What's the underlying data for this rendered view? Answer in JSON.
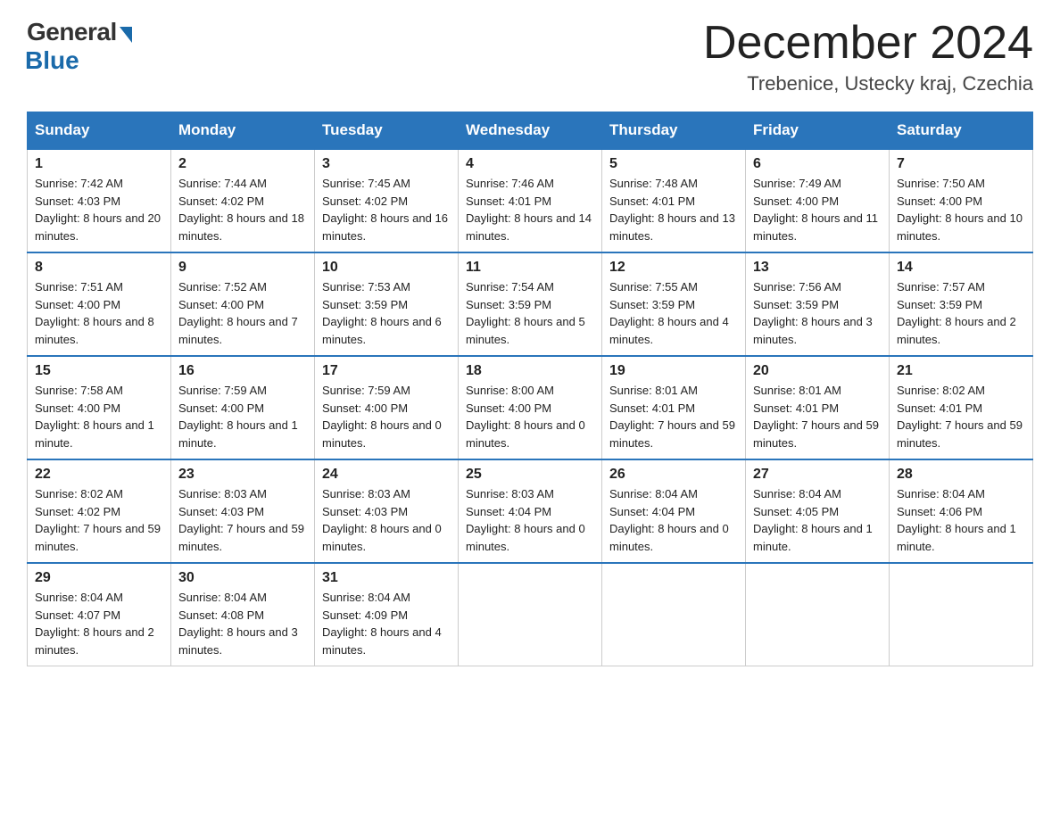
{
  "logo": {
    "general_text": "General",
    "blue_text": "Blue"
  },
  "title": {
    "month_year": "December 2024",
    "location": "Trebenice, Ustecky kraj, Czechia"
  },
  "headers": [
    "Sunday",
    "Monday",
    "Tuesday",
    "Wednesday",
    "Thursday",
    "Friday",
    "Saturday"
  ],
  "weeks": [
    [
      {
        "day": "1",
        "sunrise": "Sunrise: 7:42 AM",
        "sunset": "Sunset: 4:03 PM",
        "daylight": "Daylight: 8 hours and 20 minutes."
      },
      {
        "day": "2",
        "sunrise": "Sunrise: 7:44 AM",
        "sunset": "Sunset: 4:02 PM",
        "daylight": "Daylight: 8 hours and 18 minutes."
      },
      {
        "day": "3",
        "sunrise": "Sunrise: 7:45 AM",
        "sunset": "Sunset: 4:02 PM",
        "daylight": "Daylight: 8 hours and 16 minutes."
      },
      {
        "day": "4",
        "sunrise": "Sunrise: 7:46 AM",
        "sunset": "Sunset: 4:01 PM",
        "daylight": "Daylight: 8 hours and 14 minutes."
      },
      {
        "day": "5",
        "sunrise": "Sunrise: 7:48 AM",
        "sunset": "Sunset: 4:01 PM",
        "daylight": "Daylight: 8 hours and 13 minutes."
      },
      {
        "day": "6",
        "sunrise": "Sunrise: 7:49 AM",
        "sunset": "Sunset: 4:00 PM",
        "daylight": "Daylight: 8 hours and 11 minutes."
      },
      {
        "day": "7",
        "sunrise": "Sunrise: 7:50 AM",
        "sunset": "Sunset: 4:00 PM",
        "daylight": "Daylight: 8 hours and 10 minutes."
      }
    ],
    [
      {
        "day": "8",
        "sunrise": "Sunrise: 7:51 AM",
        "sunset": "Sunset: 4:00 PM",
        "daylight": "Daylight: 8 hours and 8 minutes."
      },
      {
        "day": "9",
        "sunrise": "Sunrise: 7:52 AM",
        "sunset": "Sunset: 4:00 PM",
        "daylight": "Daylight: 8 hours and 7 minutes."
      },
      {
        "day": "10",
        "sunrise": "Sunrise: 7:53 AM",
        "sunset": "Sunset: 3:59 PM",
        "daylight": "Daylight: 8 hours and 6 minutes."
      },
      {
        "day": "11",
        "sunrise": "Sunrise: 7:54 AM",
        "sunset": "Sunset: 3:59 PM",
        "daylight": "Daylight: 8 hours and 5 minutes."
      },
      {
        "day": "12",
        "sunrise": "Sunrise: 7:55 AM",
        "sunset": "Sunset: 3:59 PM",
        "daylight": "Daylight: 8 hours and 4 minutes."
      },
      {
        "day": "13",
        "sunrise": "Sunrise: 7:56 AM",
        "sunset": "Sunset: 3:59 PM",
        "daylight": "Daylight: 8 hours and 3 minutes."
      },
      {
        "day": "14",
        "sunrise": "Sunrise: 7:57 AM",
        "sunset": "Sunset: 3:59 PM",
        "daylight": "Daylight: 8 hours and 2 minutes."
      }
    ],
    [
      {
        "day": "15",
        "sunrise": "Sunrise: 7:58 AM",
        "sunset": "Sunset: 4:00 PM",
        "daylight": "Daylight: 8 hours and 1 minute."
      },
      {
        "day": "16",
        "sunrise": "Sunrise: 7:59 AM",
        "sunset": "Sunset: 4:00 PM",
        "daylight": "Daylight: 8 hours and 1 minute."
      },
      {
        "day": "17",
        "sunrise": "Sunrise: 7:59 AM",
        "sunset": "Sunset: 4:00 PM",
        "daylight": "Daylight: 8 hours and 0 minutes."
      },
      {
        "day": "18",
        "sunrise": "Sunrise: 8:00 AM",
        "sunset": "Sunset: 4:00 PM",
        "daylight": "Daylight: 8 hours and 0 minutes."
      },
      {
        "day": "19",
        "sunrise": "Sunrise: 8:01 AM",
        "sunset": "Sunset: 4:01 PM",
        "daylight": "Daylight: 7 hours and 59 minutes."
      },
      {
        "day": "20",
        "sunrise": "Sunrise: 8:01 AM",
        "sunset": "Sunset: 4:01 PM",
        "daylight": "Daylight: 7 hours and 59 minutes."
      },
      {
        "day": "21",
        "sunrise": "Sunrise: 8:02 AM",
        "sunset": "Sunset: 4:01 PM",
        "daylight": "Daylight: 7 hours and 59 minutes."
      }
    ],
    [
      {
        "day": "22",
        "sunrise": "Sunrise: 8:02 AM",
        "sunset": "Sunset: 4:02 PM",
        "daylight": "Daylight: 7 hours and 59 minutes."
      },
      {
        "day": "23",
        "sunrise": "Sunrise: 8:03 AM",
        "sunset": "Sunset: 4:03 PM",
        "daylight": "Daylight: 7 hours and 59 minutes."
      },
      {
        "day": "24",
        "sunrise": "Sunrise: 8:03 AM",
        "sunset": "Sunset: 4:03 PM",
        "daylight": "Daylight: 8 hours and 0 minutes."
      },
      {
        "day": "25",
        "sunrise": "Sunrise: 8:03 AM",
        "sunset": "Sunset: 4:04 PM",
        "daylight": "Daylight: 8 hours and 0 minutes."
      },
      {
        "day": "26",
        "sunrise": "Sunrise: 8:04 AM",
        "sunset": "Sunset: 4:04 PM",
        "daylight": "Daylight: 8 hours and 0 minutes."
      },
      {
        "day": "27",
        "sunrise": "Sunrise: 8:04 AM",
        "sunset": "Sunset: 4:05 PM",
        "daylight": "Daylight: 8 hours and 1 minute."
      },
      {
        "day": "28",
        "sunrise": "Sunrise: 8:04 AM",
        "sunset": "Sunset: 4:06 PM",
        "daylight": "Daylight: 8 hours and 1 minute."
      }
    ],
    [
      {
        "day": "29",
        "sunrise": "Sunrise: 8:04 AM",
        "sunset": "Sunset: 4:07 PM",
        "daylight": "Daylight: 8 hours and 2 minutes."
      },
      {
        "day": "30",
        "sunrise": "Sunrise: 8:04 AM",
        "sunset": "Sunset: 4:08 PM",
        "daylight": "Daylight: 8 hours and 3 minutes."
      },
      {
        "day": "31",
        "sunrise": "Sunrise: 8:04 AM",
        "sunset": "Sunset: 4:09 PM",
        "daylight": "Daylight: 8 hours and 4 minutes."
      },
      null,
      null,
      null,
      null
    ]
  ]
}
